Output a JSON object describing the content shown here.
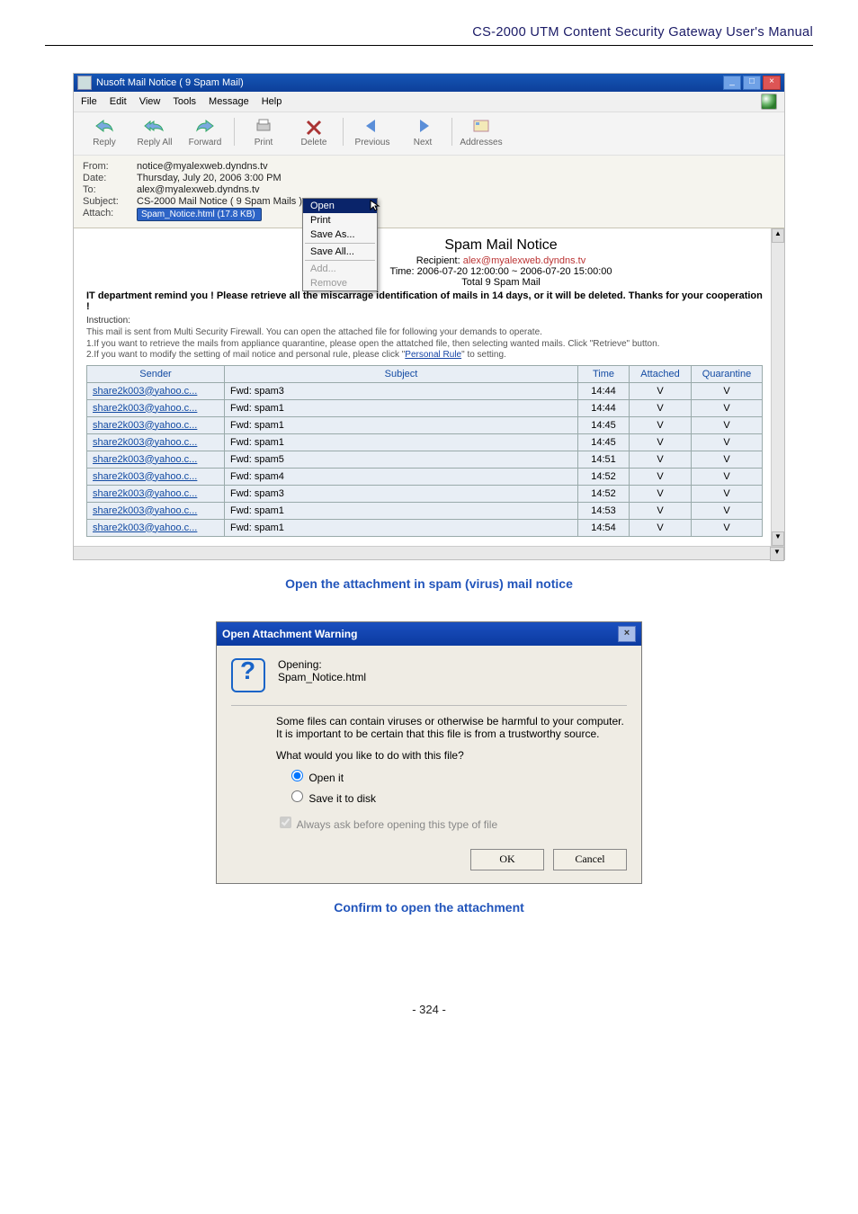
{
  "header": "CS-2000 UTM Content Security Gateway User's Manual",
  "oe": {
    "titlebar": "Nusoft Mail Notice ( 9 Spam Mail)",
    "win_btns": {
      "min": "_",
      "max": "□",
      "close": "×"
    },
    "menus": [
      "File",
      "Edit",
      "View",
      "Tools",
      "Message",
      "Help"
    ],
    "tools": [
      "Reply",
      "Reply All",
      "Forward",
      "Print",
      "Delete",
      "Previous",
      "Next",
      "Addresses"
    ],
    "info": {
      "from_label": "From:",
      "from_val": "notice@myalexweb.dyndns.tv",
      "date_label": "Date:",
      "date_val": "Thursday, July 20, 2006 3:00 PM",
      "to_label": "To:",
      "to_val": "alex@myalexweb.dyndns.tv",
      "subj_label": "Subject:",
      "subj_val": "CS-2000 Mail Notice ( 9 Spam Mails )",
      "att_label": "Attach:",
      "att_val": "Spam_Notice.html (17.8 KB)"
    },
    "ctx": {
      "open": "Open",
      "print": "Print",
      "saveas": "Save As...",
      "saveall": "Save All...",
      "add": "Add...",
      "remove": "Remove"
    },
    "notice": {
      "title": "Spam Mail Notice",
      "recip_k": "Recipient:",
      "recip_v": "alex@myalexweb.dyndns.tv",
      "time": "Time: 2006-07-20 12:00:00 ~ 2006-07-20 15:00:00",
      "total": "Total  9  Spam Mail",
      "warn": "IT department remind you ! Please retrieve all the miscarrage identification of mails in 14 days, or it will be deleted. Thanks for your cooperation !",
      "instr_head": "Instruction:",
      "instr_1": "This mail is sent from Multi Security Firewall. You can open the attached file for following your demands to operate.",
      "instr_2a": "1.If you want to retrieve the mails from appliance quarantine, please open the attatched file, then selecting wanted mails. Click \"Retrieve\" button.",
      "instr_2b_pre": "2.If you want to modify the setting of mail notice and personal rule, please click \"",
      "instr_2b_link": "Personal Rule",
      "instr_2b_post": "\" to setting."
    },
    "thead": {
      "sender": "Sender",
      "subject": "Subject",
      "time": "Time",
      "attached": "Attached",
      "quarantine": "Quarantine"
    },
    "rows": [
      {
        "sender": "share2k003@yahoo.c...",
        "subj": "Fwd: spam3",
        "time": "14:44",
        "att": "V",
        "q": "V"
      },
      {
        "sender": "share2k003@yahoo.c...",
        "subj": "Fwd: spam1",
        "time": "14:44",
        "att": "V",
        "q": "V"
      },
      {
        "sender": "share2k003@yahoo.c...",
        "subj": "Fwd: spam1",
        "time": "14:45",
        "att": "V",
        "q": "V"
      },
      {
        "sender": "share2k003@yahoo.c...",
        "subj": "Fwd: spam1",
        "time": "14:45",
        "att": "V",
        "q": "V"
      },
      {
        "sender": "share2k003@yahoo.c...",
        "subj": "Fwd: spam5",
        "time": "14:51",
        "att": "V",
        "q": "V"
      },
      {
        "sender": "share2k003@yahoo.c...",
        "subj": "Fwd: spam4",
        "time": "14:52",
        "att": "V",
        "q": "V"
      },
      {
        "sender": "share2k003@yahoo.c...",
        "subj": "Fwd: spam3",
        "time": "14:52",
        "att": "V",
        "q": "V"
      },
      {
        "sender": "share2k003@yahoo.c...",
        "subj": "Fwd: spam1",
        "time": "14:53",
        "att": "V",
        "q": "V"
      },
      {
        "sender": "share2k003@yahoo.c...",
        "subj": "Fwd: spam1",
        "time": "14:54",
        "att": "V",
        "q": "V"
      }
    ]
  },
  "caption1": "Open the attachment in spam (virus) mail notice",
  "dlg": {
    "title": "Open Attachment Warning",
    "opening": "Opening:",
    "filename": "Spam_Notice.html",
    "warn": "Some files can contain viruses or otherwise be harmful to your computer. It is important to be certain that this file is from a trustworthy source.",
    "question": "What would you like to do with this file?",
    "radio_open": "Open it",
    "radio_save": "Save it to disk",
    "always": "Always ask before opening this type of file",
    "ok": "OK",
    "cancel": "Cancel"
  },
  "caption2": "Confirm to open the attachment",
  "page": "- 324 -"
}
